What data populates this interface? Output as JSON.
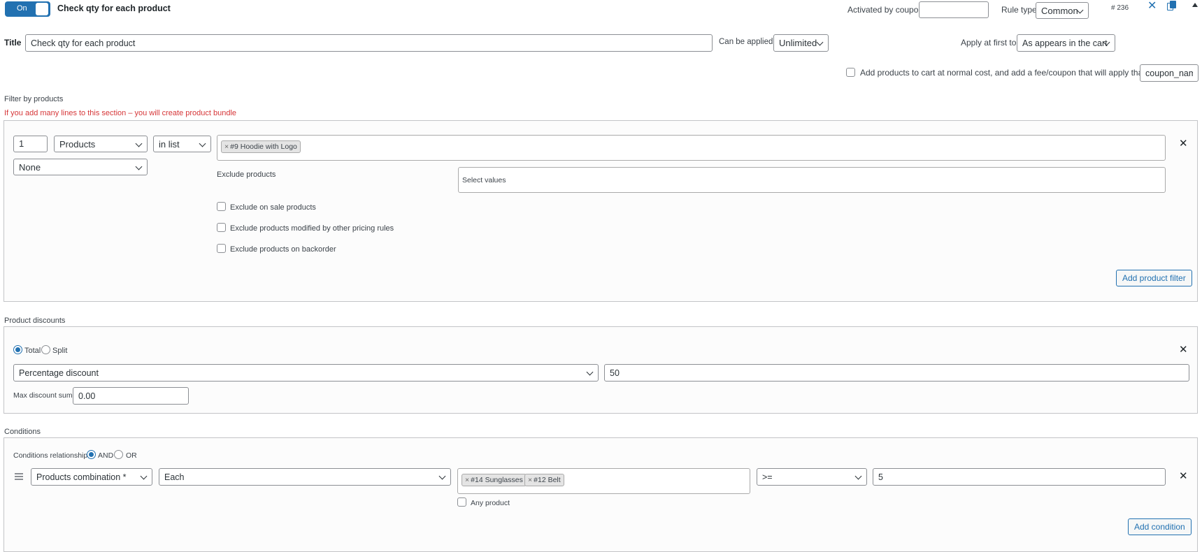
{
  "header": {
    "toggle_label": "On",
    "rule_name": "Check qty for each product",
    "activated_by_coupon_label": "Activated by coupon",
    "activated_by_coupon_value": "",
    "rule_type_label": "Rule type",
    "rule_type_value": "Common",
    "rule_id": "# 236",
    "accent": "#2271b1"
  },
  "title_row": {
    "label": "Title",
    "value": "Check qty for each product",
    "can_be_applied_label": "Can be applied:",
    "can_be_applied_value": "Unlimited",
    "apply_first_label": "Apply at first to:",
    "apply_first_value": "As appears in the cart"
  },
  "fee_row": {
    "label": "Add products to cart at normal cost, and add a fee/coupon that will apply that cost",
    "coupon_value": "coupon_nam"
  },
  "filter": {
    "section_title": "Filter by products",
    "warning": "If you add many lines to this section – you will create product bundle",
    "warning_color": "#d63638",
    "qty": "1",
    "type": "Products",
    "method": "in list",
    "extra": "None",
    "tags": [
      "#9 Hoodie with Logo"
    ],
    "exclude_label": "Exclude products",
    "exclude_placeholder": "Select values",
    "exclude_on_sale": "Exclude on sale products",
    "exclude_modified": "Exclude products modified by other pricing rules",
    "exclude_backorder": "Exclude products on backorder",
    "add_button": "Add product filter"
  },
  "discounts": {
    "section_title": "Product discounts",
    "total_label": "Total",
    "split_label": "Split",
    "type": "Percentage discount",
    "value": "50",
    "max_label": "Max discount sum:",
    "max_value": "0.00"
  },
  "conditions": {
    "section_title": "Conditions",
    "relationship_label": "Conditions relationship",
    "and_label": "AND",
    "or_label": "OR",
    "type": "Products combination *",
    "mode": "Each",
    "tags": [
      "#14 Sunglasses",
      "#12 Belt"
    ],
    "any_product_label": "Any product",
    "operator": ">=",
    "value": "5",
    "add_button": "Add condition"
  }
}
